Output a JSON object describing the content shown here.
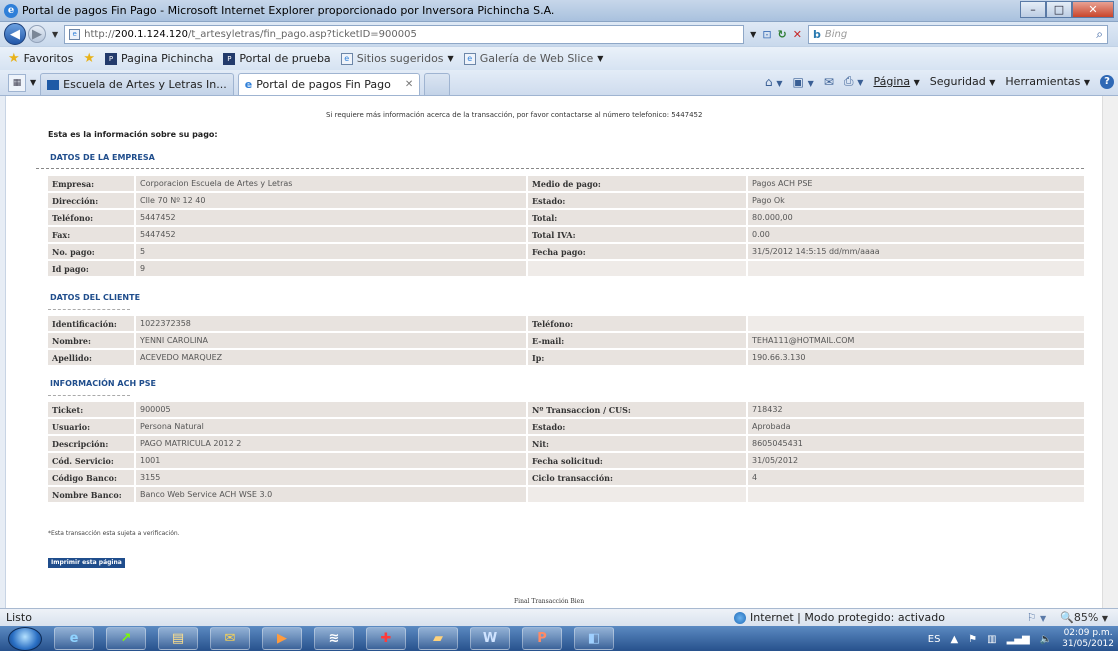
{
  "window": {
    "title": "Portal de pagos Fin Pago - Microsoft Internet Explorer proporcionado por Inversora Pichincha S.A."
  },
  "address": {
    "url_prefix": "http://",
    "url_host": "200.1.124.120",
    "url_path": "/t_artesyletras/fin_pago.asp?ticketID=900005",
    "search_placeholder": "Bing"
  },
  "favorites": {
    "label": "Favoritos",
    "items": [
      "Pagina Pichincha",
      "Portal de prueba",
      "Sitios sugeridos",
      "Galería de Web Slice"
    ]
  },
  "tabs": [
    {
      "label": "Escuela de Artes y Letras In..."
    },
    {
      "label": "Portal de pagos Fin Pago"
    }
  ],
  "commandbar": {
    "page": "Página",
    "safety": "Seguridad",
    "tools": "Herramientas"
  },
  "page": {
    "top_note": "Si requiere más información acerca de la transacción, por favor contactarse al número telefonico: 5447452",
    "intro": "Esta es la información sobre su pago:",
    "section_empresa": "DATOS DE LA EMPRESA",
    "section_cliente": "DATOS DEL CLIENTE",
    "section_ach": "INFORMACIÓN ACH PSE",
    "empresa_rows": [
      [
        "Empresa:",
        "Corporacion Escuela de Artes y Letras",
        "Medio de pago:",
        "Pagos ACH PSE"
      ],
      [
        "Dirección:",
        "Clle 70 Nº 12 40",
        "Estado:",
        "Pago Ok"
      ],
      [
        "Teléfono:",
        "5447452",
        "Total:",
        "80.000,00"
      ],
      [
        "Fax:",
        "5447452",
        "Total IVA:",
        "0.00"
      ],
      [
        "No. pago:",
        "5",
        "Fecha pago:",
        "31/5/2012 14:5:15 dd/mm/aaaa"
      ],
      [
        "Id pago:",
        "9",
        "",
        ""
      ]
    ],
    "cliente_rows": [
      [
        "Identificación:",
        "1022372358",
        "Teléfono:",
        ""
      ],
      [
        "Nombre:",
        "YENNI CAROLINA",
        "E-mail:",
        "TEHA111@HOTMAIL.COM"
      ],
      [
        "Apellido:",
        "ACEVEDO MARQUEZ",
        "Ip:",
        "190.66.3.130"
      ]
    ],
    "ach_rows": [
      [
        "Ticket:",
        "900005",
        "Nº Transaccion / CUS:",
        "718432"
      ],
      [
        "Usuario:",
        "Persona Natural",
        "Estado:",
        "Aprobada"
      ],
      [
        "Descripción:",
        "PAGO MATRICULA 2012 2",
        "Nit:",
        "8605045431"
      ],
      [
        "Cód. Servicio:",
        "1001",
        "Fecha solicitud:",
        "31/05/2012"
      ],
      [
        "Código Banco:",
        "3155",
        "Ciclo transacción:",
        "4"
      ],
      [
        "Nombre Banco:",
        "Banco Web Service ACH WSE 3.0",
        "",
        ""
      ]
    ],
    "footnote": "*Esta transacción esta sujeta a verificación.",
    "print_button": "Imprimir esta página",
    "bottom_message": "Final Transacción Bien"
  },
  "status": {
    "left": "Listo",
    "zone": "Internet | Modo protegido: activado",
    "zoom": "85%"
  },
  "taskbar": {
    "lang": "ES",
    "time": "02:09 p.m.",
    "date": "31/05/2012"
  },
  "colors": {
    "section_heading": "#1f4d8c",
    "cell_bg": "#e8e3df",
    "print_button_bg": "#1f4d8c"
  }
}
